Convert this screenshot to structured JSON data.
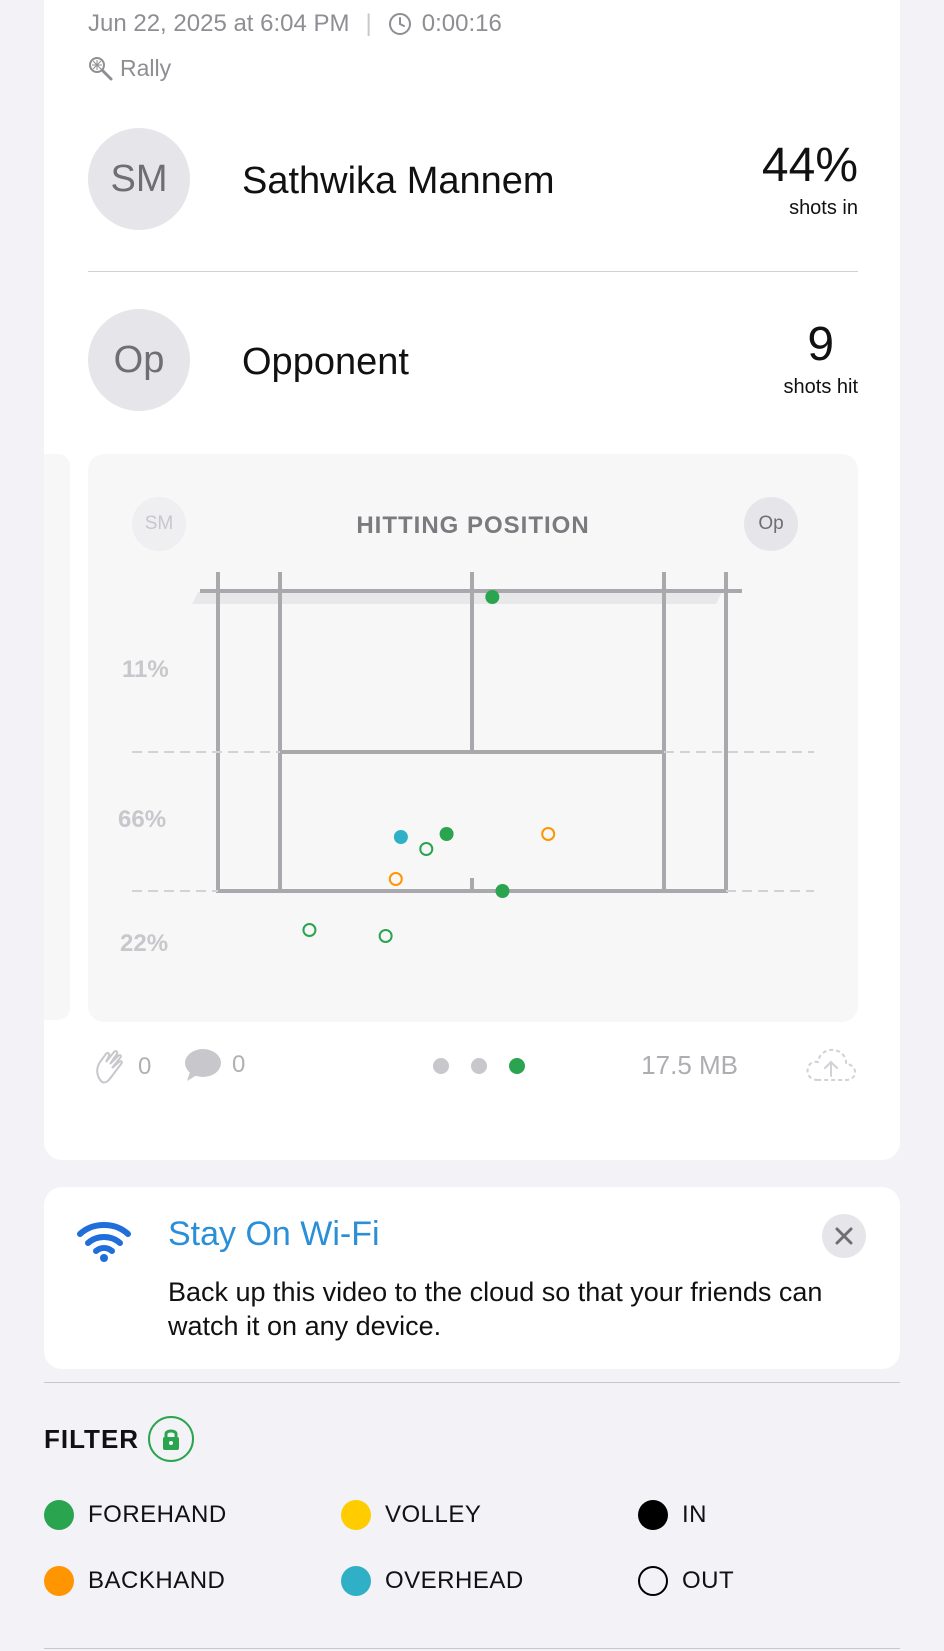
{
  "session": {
    "datetime": "Jun 22, 2025 at 6:04 PM",
    "duration": "0:00:16",
    "type": "Rally"
  },
  "players": [
    {
      "initials": "SM",
      "name": "Sathwika Mannem",
      "stat_value": "44%",
      "stat_label": "shots in"
    },
    {
      "initials": "Op",
      "name": "Opponent",
      "stat_value": "9",
      "stat_label": "shots hit"
    }
  ],
  "chart": {
    "title": "HITTING POSITION",
    "left_avatar": "SM",
    "right_avatar": "Op",
    "zone_labels": [
      "11%",
      "66%",
      "22%"
    ]
  },
  "chart_data": {
    "type": "scatter",
    "title": "HITTING POSITION",
    "zones": [
      {
        "label": "11%",
        "value": 11
      },
      {
        "label": "66%",
        "value": 66
      },
      {
        "label": "22%",
        "value": 22
      }
    ],
    "points": [
      {
        "x": 0.54,
        "y": 0.02,
        "shot": "forehand",
        "result": "in"
      },
      {
        "x": 0.36,
        "y": 0.82,
        "shot": "overhead",
        "result": "in"
      },
      {
        "x": 0.41,
        "y": 0.86,
        "shot": "forehand",
        "result": "out"
      },
      {
        "x": 0.45,
        "y": 0.81,
        "shot": "forehand",
        "result": "in"
      },
      {
        "x": 0.65,
        "y": 0.81,
        "shot": "backhand",
        "result": "out"
      },
      {
        "x": 0.35,
        "y": 0.96,
        "shot": "backhand",
        "result": "out"
      },
      {
        "x": 0.56,
        "y": 1.0,
        "shot": "forehand",
        "result": "in"
      },
      {
        "x": 0.18,
        "y": 1.13,
        "shot": "forehand",
        "result": "out"
      },
      {
        "x": 0.33,
        "y": 1.15,
        "shot": "forehand",
        "result": "out"
      }
    ]
  },
  "footer": {
    "claps": "0",
    "comments": "0",
    "page_count": 3,
    "active_page": 2,
    "file_size": "17.5 MB"
  },
  "wifi_banner": {
    "title": "Stay On Wi-Fi",
    "body": "Back up this video to the cloud so that your friends can watch it on any device."
  },
  "filter": {
    "label": "FILTER",
    "items": [
      {
        "label": "FOREHAND",
        "color": "#2aa44f",
        "style": "filled"
      },
      {
        "label": "VOLLEY",
        "color": "#ffcc00",
        "style": "filled"
      },
      {
        "label": "IN",
        "color": "#000000",
        "style": "filled"
      },
      {
        "label": "BACKHAND",
        "color": "#ff9500",
        "style": "filled"
      },
      {
        "label": "OVERHEAD",
        "color": "#30b0c7",
        "style": "filled"
      },
      {
        "label": "OUT",
        "color": "#000000",
        "style": "outline"
      }
    ]
  },
  "colors": {
    "forehand": "#2aa44f",
    "backhand": "#ff9500",
    "volley": "#ffcc00",
    "overhead": "#30b0c7",
    "accent_blue": "#2b8fd8"
  }
}
